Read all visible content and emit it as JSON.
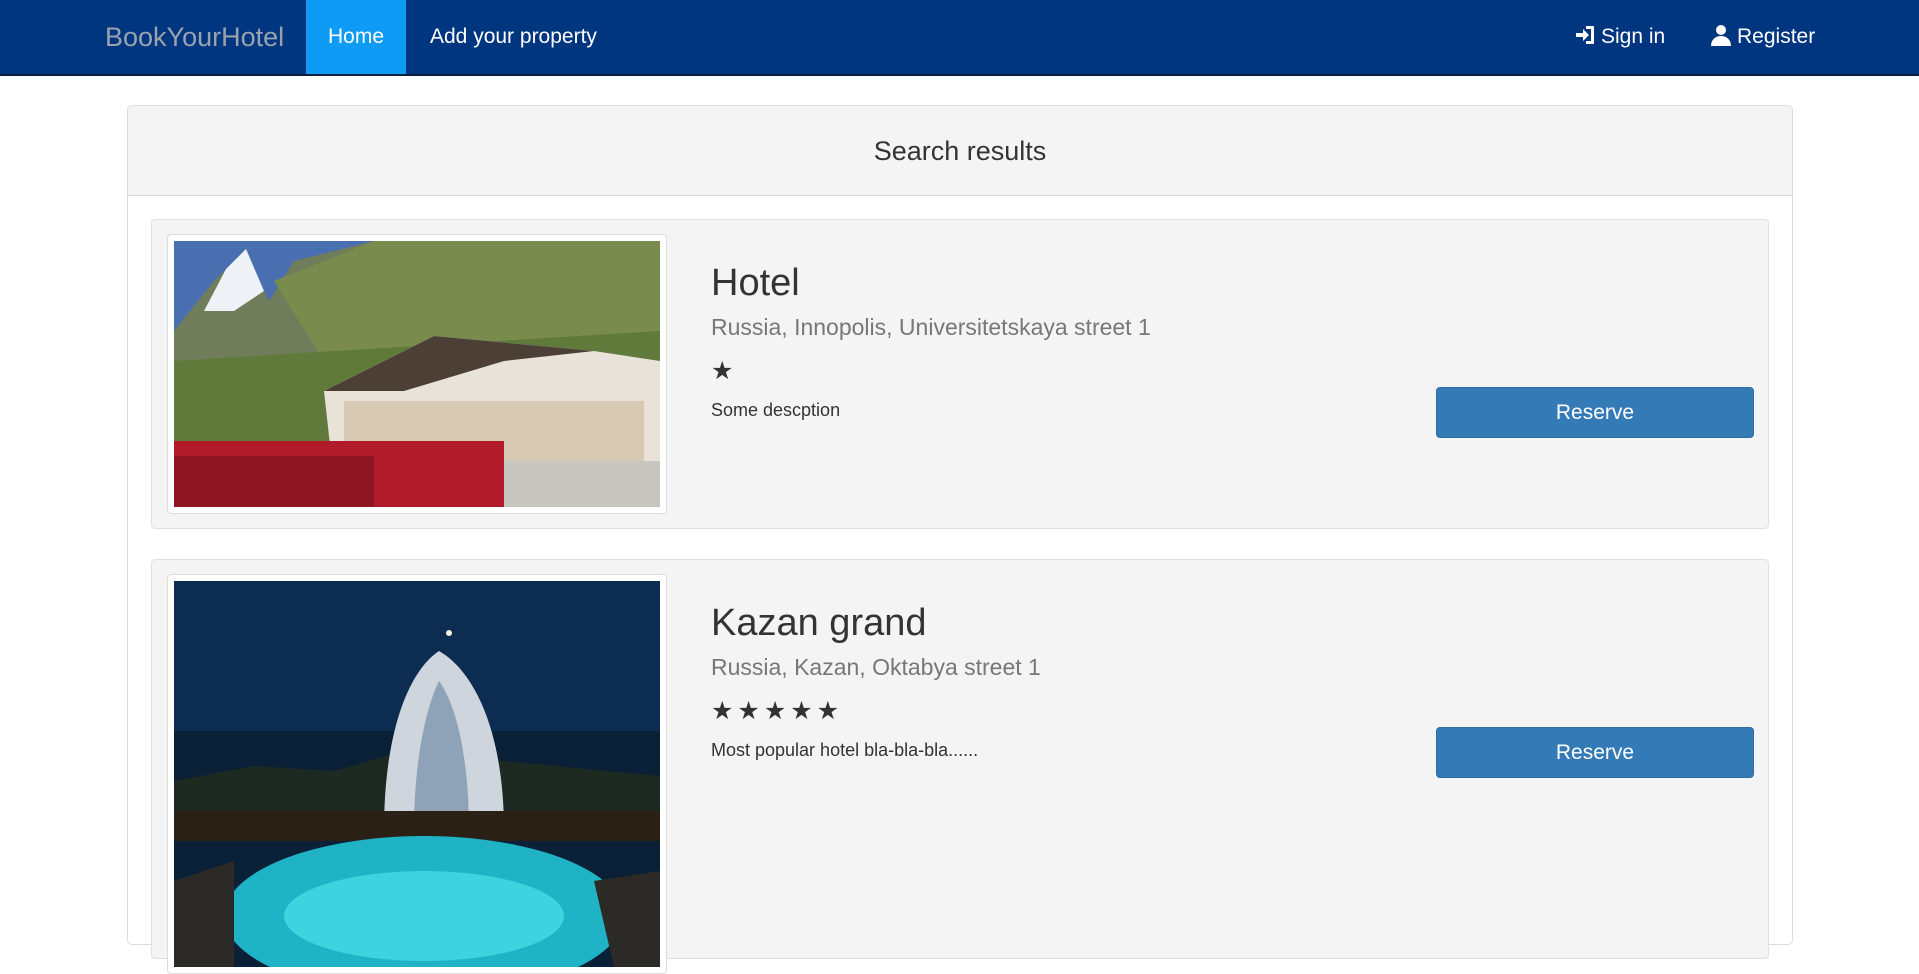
{
  "navbar": {
    "brand": "BookYourHotel",
    "items": [
      {
        "label": "Home",
        "active": true
      },
      {
        "label": "Add your property",
        "active": false
      }
    ],
    "sign_in": {
      "label": "Sign in",
      "icon": "sign-in-icon"
    },
    "register": {
      "label": "Register",
      "icon": "user-icon"
    }
  },
  "panel": {
    "title": "Search results"
  },
  "hotels": [
    {
      "name": "Hotel",
      "address": "Russia, Innopolis, Universitetskaya street 1",
      "stars": 1,
      "stars_text": "★",
      "description": "Some descption",
      "reserve_label": "Reserve",
      "image": "mountain-hotel-photo"
    },
    {
      "name": "Kazan grand",
      "address": "Russia, Kazan, Oktabya street 1",
      "stars": 5,
      "stars_text": "★★★★★",
      "description": "Most popular hotel bla-bla-bla......",
      "reserve_label": "Reserve",
      "image": "night-resort-pool-photo"
    }
  ],
  "colors": {
    "navbar_bg": "#003580",
    "active_tab": "#0e9bf5",
    "button": "#337ab7"
  }
}
